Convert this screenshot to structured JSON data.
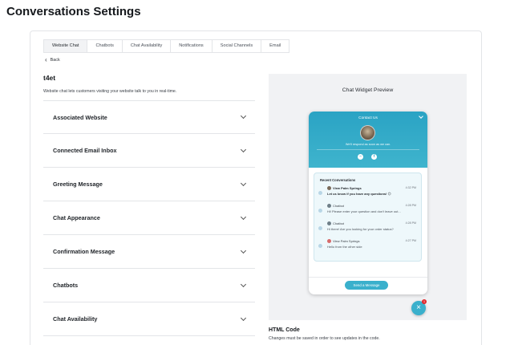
{
  "page": {
    "title": "Conversations Settings"
  },
  "tabs": [
    {
      "label": "Website Chat",
      "active": true
    },
    {
      "label": "Chatbots",
      "active": false
    },
    {
      "label": "Chat Availability",
      "active": false
    },
    {
      "label": "Notifications",
      "active": false
    },
    {
      "label": "Social Channels",
      "active": false
    },
    {
      "label": "Email",
      "active": false
    }
  ],
  "back": {
    "label": "Back",
    "icon": "chevron-left-icon"
  },
  "channel": {
    "title": "t4et",
    "description": "Website chat lets customers visiting your website talk to you in real-time."
  },
  "sections": [
    {
      "label": "Associated Website"
    },
    {
      "label": "Connected Email Inbox"
    },
    {
      "label": "Greeting Message"
    },
    {
      "label": "Chat Appearance"
    },
    {
      "label": "Confirmation Message"
    },
    {
      "label": "Chatbots"
    },
    {
      "label": "Chat Availability"
    }
  ],
  "preview": {
    "title": "Chat Widget Preview",
    "header": {
      "contact_label": "Contact Us",
      "respond_text": "We'll respond as soon as we can.",
      "social_icons": [
        "messenger-icon",
        "facebook-icon"
      ]
    },
    "recent_title": "Recent Conversations",
    "conversations": [
      {
        "name": "View Palm Springs",
        "time": "4:32 PM",
        "message": "Let us know if you have any questions! 😊",
        "unread": true,
        "avatar": "business"
      },
      {
        "name": "Chatbot",
        "time": "4:28 PM",
        "message": "Hi! Please enter your question and don't leave out...",
        "unread": false,
        "avatar": "chatbot"
      },
      {
        "name": "Chatbot",
        "time": "4:28 PM",
        "message": "Hi there! Are you looking for your order status?",
        "unread": false,
        "avatar": "chatbot"
      },
      {
        "name": "View Palm Springs",
        "time": "4:27 PM",
        "message": "Hello from the other side",
        "unread": false,
        "avatar": "red"
      }
    ],
    "send_button": "Send a Message",
    "fab_badge": "1"
  },
  "html_code": {
    "title": "HTML Code",
    "note": "Changes must be saved in order to see updates in the code."
  },
  "colors": {
    "accent": "#3ab0cc",
    "header_gradient_start": "#2aa3c4",
    "badge": "#e0282c"
  }
}
